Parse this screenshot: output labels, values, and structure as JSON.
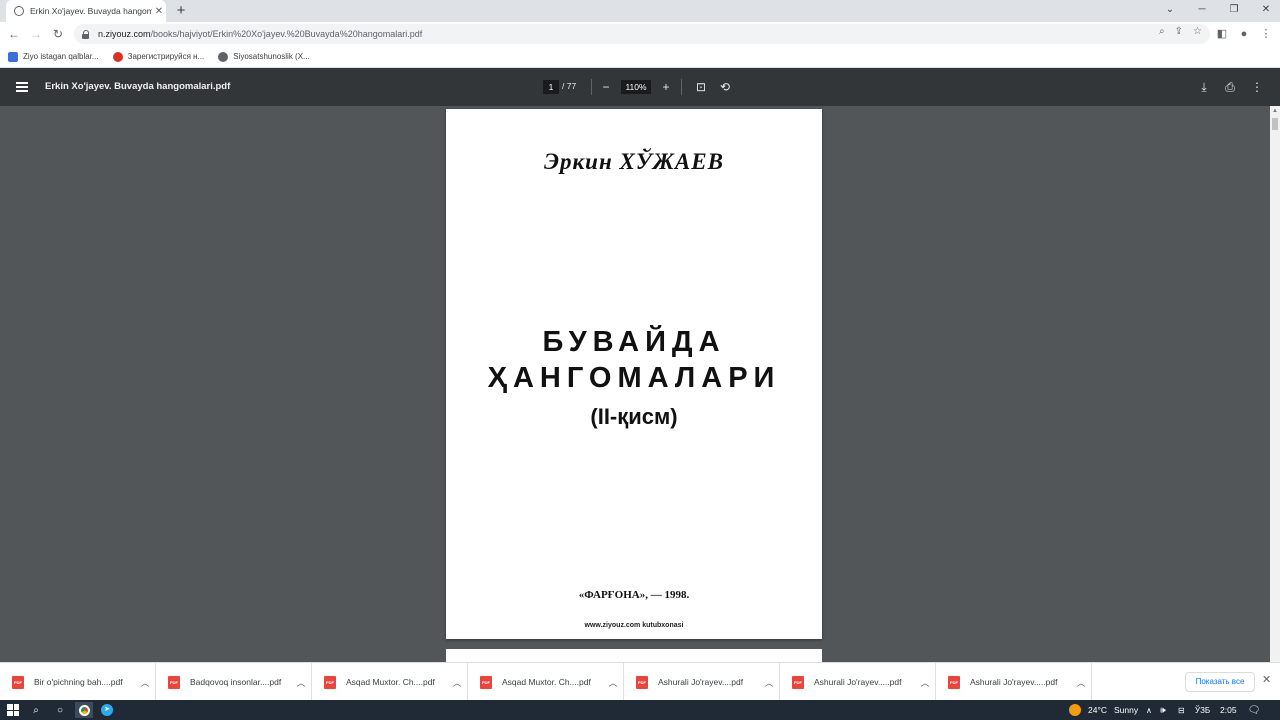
{
  "browser": {
    "tab_title": "Erkin Xo'jayev. Buvayda hangoma",
    "tab_close": "✕",
    "new_tab": "+",
    "url_host": "n.ziyouz.com",
    "url_path": "/books/hajviyot/Erkin%20Xo'jayev.%20Buvayda%20hangomalari.pdf",
    "bookmarks": [
      {
        "label": "Ziyo istagan qalblar...",
        "color": "#3b6fd8"
      },
      {
        "label": "Зарегистрируйся н...",
        "color": "#d93025"
      },
      {
        "label": "Siyosatshunoslik (X...",
        "color": "#5f6368"
      }
    ]
  },
  "pdf_toolbar": {
    "title": "Erkin Xo'jayev. Buvayda hangomalari.pdf",
    "page_current": "1",
    "page_total": "/ 77",
    "zoom": "110%",
    "zoom_out": "−",
    "zoom_in": "+"
  },
  "document": {
    "author": "Эркин  ХЎЖАЕВ",
    "title_line1": "БУВАЙДА",
    "title_line2": "ҲАНГОМАЛАРИ",
    "part": "(II-қисм)",
    "publisher": "«ФАРҒОНА», — 1998.",
    "site": "www.ziyouz.com kutubxonasi"
  },
  "downloads": {
    "items": [
      {
        "name": "Bir o'pichning bah....pdf"
      },
      {
        "name": "Badqovoq insonlar....pdf"
      },
      {
        "name": "Asqad Muxtor. Ch....pdf"
      },
      {
        "name": "Asqad Muxtor. Ch....pdf"
      },
      {
        "name": "Ashurali Jo'rayev....pdf"
      },
      {
        "name": "Ashurali Jo'rayev.....pdf"
      },
      {
        "name": "Ashurali Jo'rayev.....pdf"
      }
    ],
    "show_all": "Показать все",
    "pdf_badge": "PDF"
  },
  "taskbar": {
    "temperature": "24°C",
    "weather": "Sunny",
    "lang": "ЎЗБ",
    "time": "2:05"
  }
}
